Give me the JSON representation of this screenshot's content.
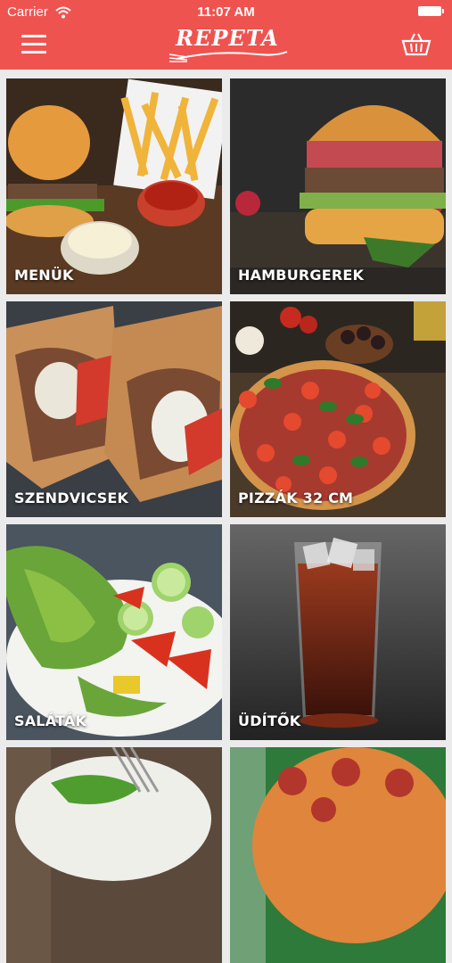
{
  "status_bar": {
    "carrier": "Carrier",
    "time": "11:07 AM"
  },
  "header": {
    "logo_text": "REPETA"
  },
  "icons": {
    "menu": "hamburger-menu-icon",
    "cart": "shopping-basket-icon",
    "wifi": "wifi-icon",
    "battery": "battery-icon"
  },
  "colors": {
    "header": "#ef5350",
    "background": "#ebebeb",
    "label": "#ffffff"
  },
  "categories": [
    {
      "label": "MENÜK"
    },
    {
      "label": "HAMBURGEREK"
    },
    {
      "label": "SZENDVICSEK"
    },
    {
      "label": "PIZZÁK 32 CM"
    },
    {
      "label": "SALÁTÁK"
    },
    {
      "label": "ÜDÍTŐK"
    },
    {
      "label": ""
    },
    {
      "label": ""
    }
  ]
}
